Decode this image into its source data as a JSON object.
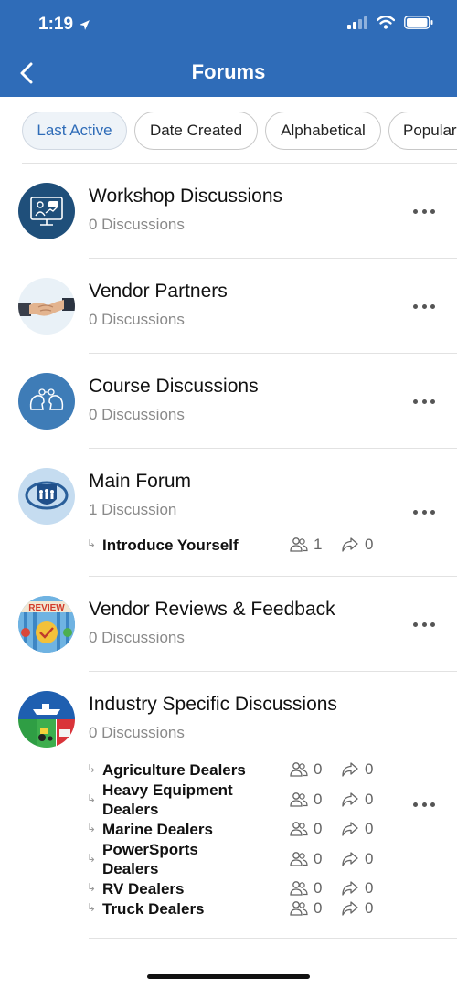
{
  "status_bar": {
    "time": "1:19"
  },
  "header": {
    "title": "Forums"
  },
  "sort_chips": [
    {
      "label": "Last Active",
      "active": true
    },
    {
      "label": "Date Created",
      "active": false
    },
    {
      "label": "Alphabetical",
      "active": false
    },
    {
      "label": "Popular",
      "active": false
    }
  ],
  "forums": [
    {
      "name": "Workshop Discussions",
      "count": "0 Discussions",
      "icon": "presentation-icon"
    },
    {
      "name": "Vendor Partners",
      "count": "0 Discussions",
      "icon": "handshake-icon"
    },
    {
      "name": "Course Discussions",
      "count": "0 Discussions",
      "icon": "heads-idea-icon"
    },
    {
      "name": "Main Forum",
      "count": "1 Discussion",
      "icon": "team-shield-icon",
      "subforums": [
        {
          "name": "Introduce Yourself",
          "members": "1",
          "replies": "0"
        }
      ]
    },
    {
      "name": "Vendor Reviews & Feedback",
      "count": "0 Discussions",
      "icon": "review-icon"
    },
    {
      "name": "Industry Specific Discussions",
      "count": "0 Discussions",
      "icon": "industry-collage-icon",
      "subforums": [
        {
          "name": "Agriculture Dealers",
          "members": "0",
          "replies": "0"
        },
        {
          "name": "Heavy Equipment Dealers",
          "line1": "Heavy Equipment",
          "line2": "Dealers",
          "members": "0",
          "replies": "0"
        },
        {
          "name": "Marine Dealers",
          "members": "0",
          "replies": "0"
        },
        {
          "name": "PowerSports Dealers",
          "line1": "PowerSports",
          "line2": "Dealers",
          "members": "0",
          "replies": "0"
        },
        {
          "name": "RV Dealers",
          "members": "0",
          "replies": "0"
        },
        {
          "name": "Truck Dealers",
          "members": "0",
          "replies": "0"
        }
      ]
    }
  ],
  "colors": {
    "header": "#2f6cb8",
    "accent": "#2f6cb8",
    "muted": "#8a8a8a"
  }
}
